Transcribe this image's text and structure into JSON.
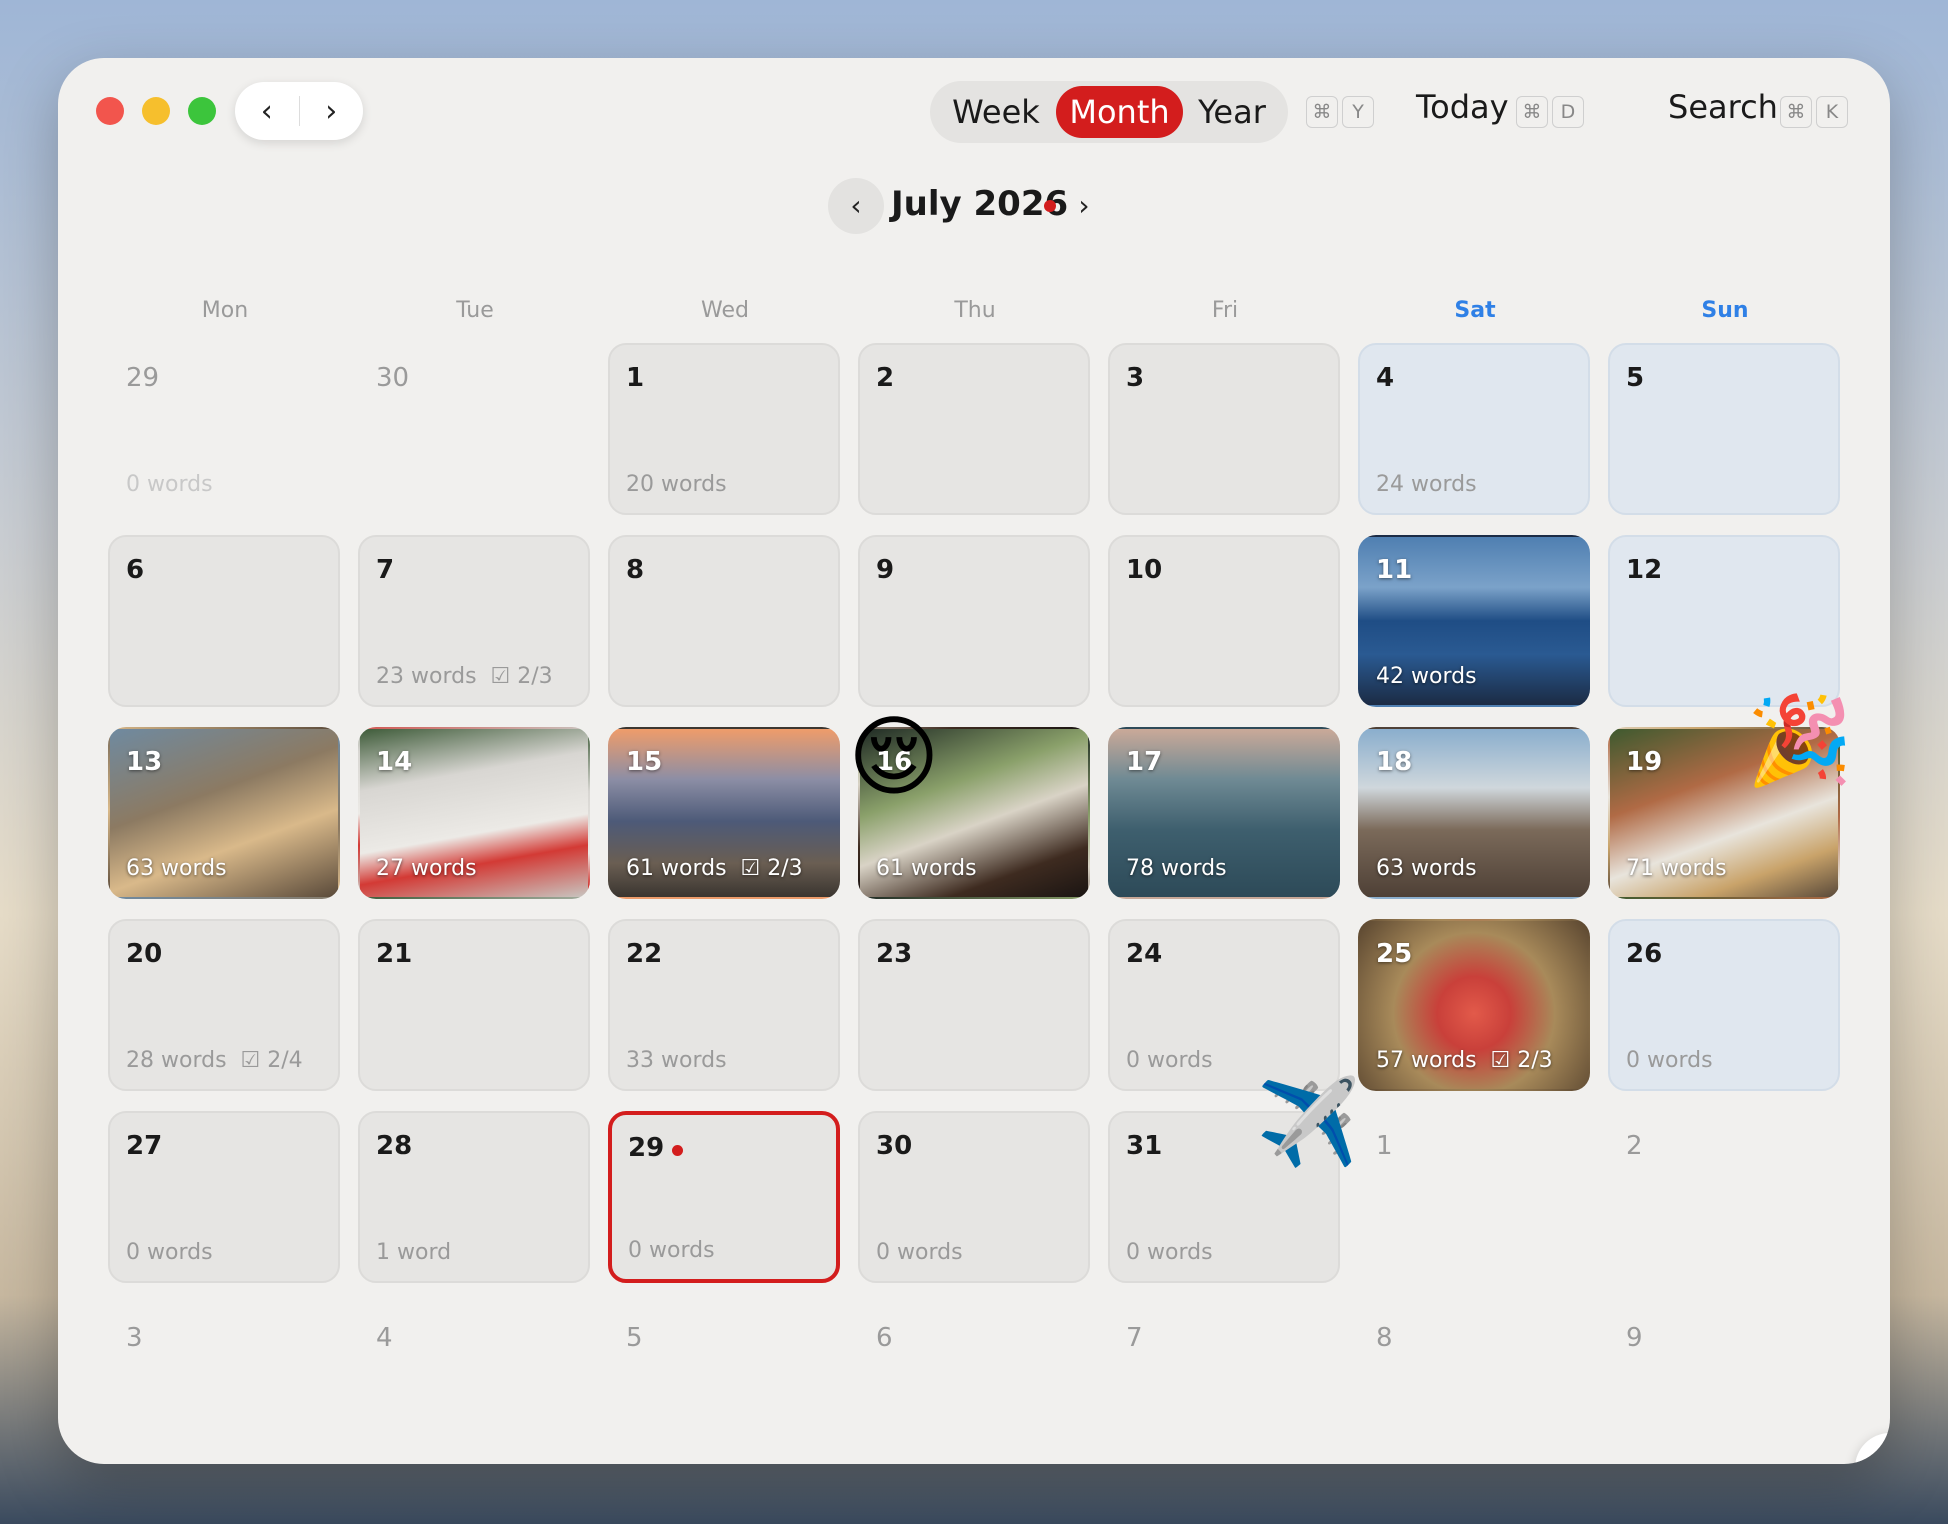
{
  "toolbar": {
    "views": [
      "Week",
      "Month",
      "Year"
    ],
    "active_view": "Month",
    "view_shortcut": [
      "⌘",
      "Y"
    ],
    "today_label": "Today",
    "today_shortcut": [
      "⌘",
      "D"
    ],
    "search_label": "Search",
    "search_shortcut": [
      "⌘",
      "K"
    ]
  },
  "month_nav": {
    "title": "July 2026",
    "prev_icon": "‹",
    "next_icon": "›"
  },
  "weekdays": [
    "Mon",
    "Tue",
    "Wed",
    "Thu",
    "Fri",
    "Sat",
    "Sun"
  ],
  "weeks": [
    [
      {
        "day": "29",
        "words": "0 words",
        "type": "other"
      },
      {
        "day": "30",
        "words": "",
        "type": "other"
      },
      {
        "day": "1",
        "words": "20 words"
      },
      {
        "day": "2",
        "words": ""
      },
      {
        "day": "3",
        "words": ""
      },
      {
        "day": "4",
        "words": "24 words",
        "weekend": true
      },
      {
        "day": "5",
        "words": "",
        "weekend": true
      }
    ],
    [
      {
        "day": "6",
        "words": ""
      },
      {
        "day": "7",
        "words": "23 words",
        "task": "2/3"
      },
      {
        "day": "8",
        "words": ""
      },
      {
        "day": "9",
        "words": ""
      },
      {
        "day": "10",
        "words": ""
      },
      {
        "day": "11",
        "words": "42 words",
        "photo": "sea1"
      },
      {
        "day": "12",
        "words": "",
        "weekend": true
      }
    ],
    [
      {
        "day": "13",
        "words": "63 words",
        "photo": "13"
      },
      {
        "day": "14",
        "words": "27 words",
        "photo": "14"
      },
      {
        "day": "15",
        "words": "61 words",
        "task": "2/3",
        "photo": "15"
      },
      {
        "day": "16",
        "words": "61 words",
        "photo": "16"
      },
      {
        "day": "17",
        "words": "78 words",
        "photo": "17"
      },
      {
        "day": "18",
        "words": "63 words",
        "photo": "18"
      },
      {
        "day": "19",
        "words": "71 words",
        "photo": "19"
      }
    ],
    [
      {
        "day": "20",
        "words": "28 words",
        "task": "2/4"
      },
      {
        "day": "21",
        "words": ""
      },
      {
        "day": "22",
        "words": "33 words"
      },
      {
        "day": "23",
        "words": ""
      },
      {
        "day": "24",
        "words": "0 words"
      },
      {
        "day": "25",
        "words": "57 words",
        "task": "2/3",
        "photo": "25"
      },
      {
        "day": "26",
        "words": "0 words",
        "weekend": true
      }
    ],
    [
      {
        "day": "27",
        "words": "0 words"
      },
      {
        "day": "28",
        "words": "1 word"
      },
      {
        "day": "29",
        "words": "0 words",
        "today": true
      },
      {
        "day": "30",
        "words": "0 words"
      },
      {
        "day": "31",
        "words": "0 words"
      },
      {
        "day": "1",
        "words": "",
        "type": "other"
      },
      {
        "day": "2",
        "words": "",
        "type": "other"
      }
    ],
    [
      {
        "day": "3",
        "words": "",
        "type": "other"
      },
      {
        "day": "4",
        "words": "",
        "type": "other"
      },
      {
        "day": "5",
        "words": "",
        "type": "other"
      },
      {
        "day": "6",
        "words": "",
        "type": "other"
      },
      {
        "day": "7",
        "words": "",
        "type": "other"
      },
      {
        "day": "8",
        "words": "",
        "type": "other"
      },
      {
        "day": "9",
        "words": "",
        "type": "other"
      }
    ]
  ],
  "stickers": {
    "relieved": "😌",
    "party": "🎉",
    "airplane": "✈️"
  },
  "icons": {
    "back": "‹",
    "forward": "›",
    "dock": "command-icon"
  },
  "colors": {
    "accent": "#d31d1d",
    "weekend": "#2f80e6"
  }
}
